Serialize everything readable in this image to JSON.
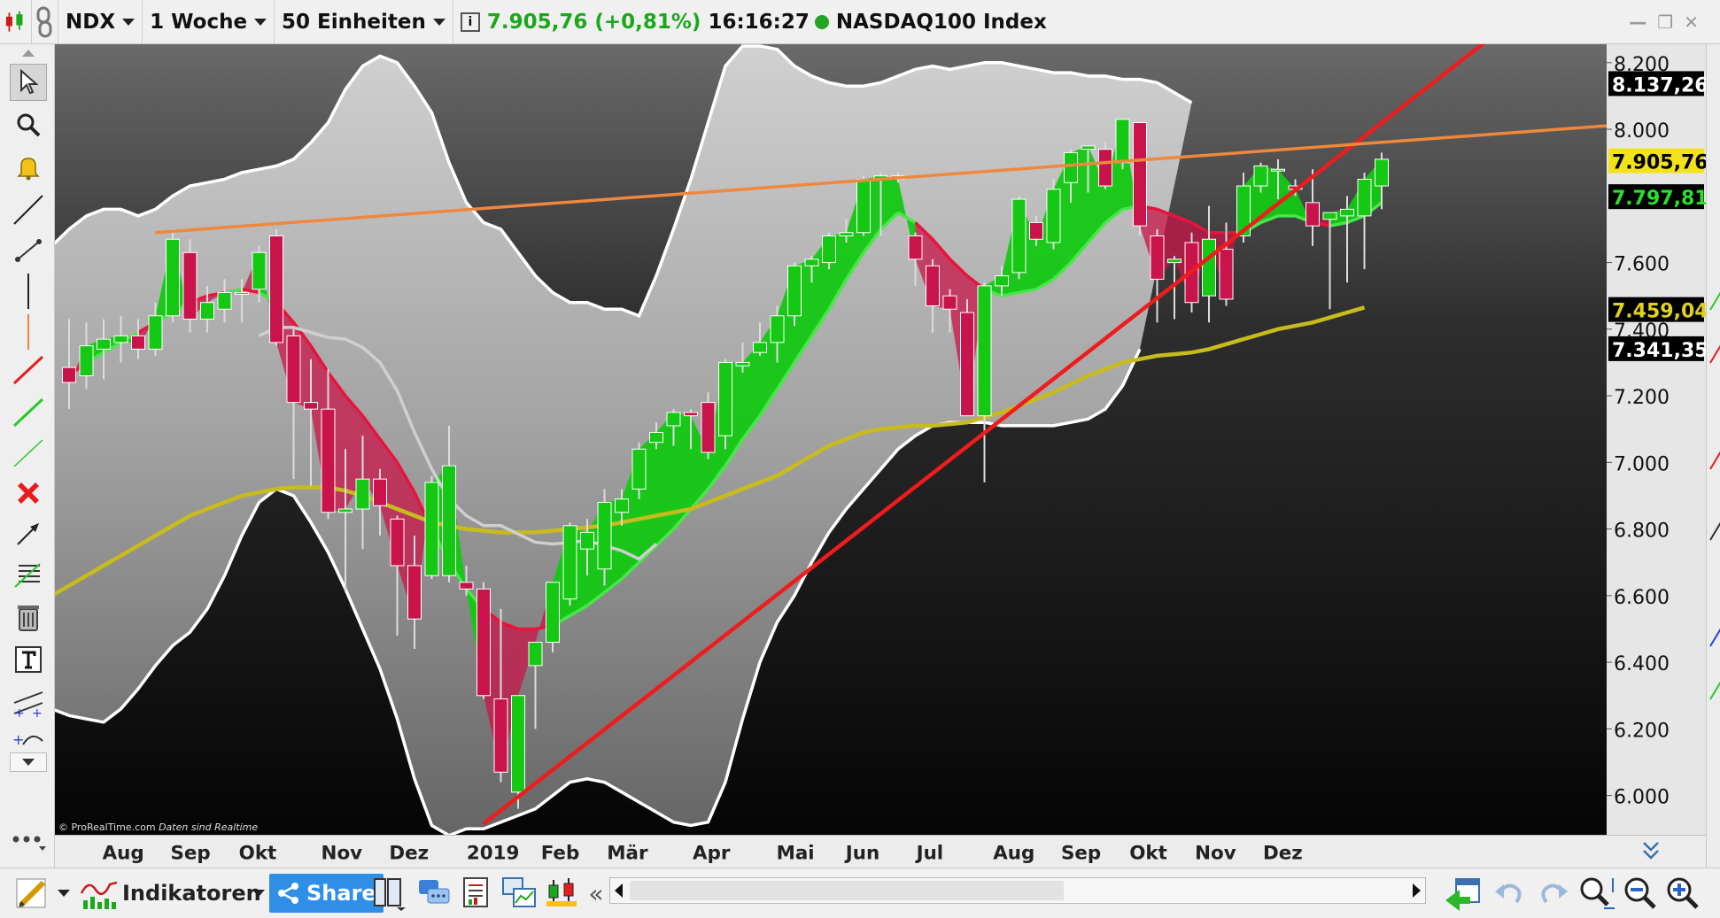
{
  "toolbar": {
    "symbol": "NDX",
    "period": "1 Woche",
    "units": "50 Einheiten",
    "last": "7.905,76",
    "change": "(+0,81%)",
    "time": "16:16:27",
    "instrument": "NASDAQ100 Index"
  },
  "bottom": {
    "indicators_label": "Indikatoren",
    "share_label": "Share"
  },
  "colors": {
    "bull": "#14c814",
    "bear": "#c8144a",
    "trendline": "#ee1c1c",
    "resistance": "#f0883c",
    "ma": "#c8bc1c",
    "band": "#ffffff",
    "live_dot": "#23a523"
  },
  "chart_data": {
    "type": "candlestick",
    "watermark": "© ProRealTime.com",
    "watermark_note": "Daten sind Realtime",
    "x_axis_labels": [
      "Aug",
      "Sep",
      "Okt",
      "Nov",
      "Dez",
      "2019",
      "Feb",
      "Mär",
      "Apr",
      "Mai",
      "Jun",
      "Jul",
      "Aug",
      "Sep",
      "Okt",
      "Nov",
      "Dez"
    ],
    "y_ticks": [
      "8.200",
      "8.000",
      "7.600",
      "7.400",
      "7.200",
      "7.000",
      "6.800",
      "6.600",
      "6.400",
      "6.200",
      "6.000"
    ],
    "ylim": [
      5890,
      8250
    ],
    "price_tags": [
      {
        "label": "8.137,26",
        "value": 8137.26,
        "bg": "#000000",
        "fg": "#ffffff"
      },
      {
        "label": "7.905,76",
        "value": 7905.76,
        "bg": "#f2e21a",
        "fg": "#000000"
      },
      {
        "label": "7.797,81",
        "value": 7797.81,
        "bg": "#000000",
        "fg": "#2be02b"
      },
      {
        "label": "7.459,04",
        "value": 7459.04,
        "bg": "#000000",
        "fg": "#e0d21c"
      },
      {
        "label": "7.341,35",
        "value": 7341.35,
        "bg": "#000000",
        "fg": "#ffffff"
      }
    ],
    "candles": [
      {
        "o": 7285,
        "h": 7430,
        "l": 7160,
        "c": 7240
      },
      {
        "o": 7260,
        "h": 7420,
        "l": 7220,
        "c": 7350
      },
      {
        "o": 7340,
        "h": 7430,
        "l": 7250,
        "c": 7370
      },
      {
        "o": 7360,
        "h": 7440,
        "l": 7300,
        "c": 7380
      },
      {
        "o": 7380,
        "h": 7430,
        "l": 7310,
        "c": 7340
      },
      {
        "o": 7340,
        "h": 7480,
        "l": 7320,
        "c": 7440
      },
      {
        "o": 7440,
        "h": 7700,
        "l": 7420,
        "c": 7670
      },
      {
        "o": 7630,
        "h": 7670,
        "l": 7390,
        "c": 7430
      },
      {
        "o": 7430,
        "h": 7530,
        "l": 7390,
        "c": 7480
      },
      {
        "o": 7460,
        "h": 7550,
        "l": 7420,
        "c": 7510
      },
      {
        "o": 7510,
        "h": 7550,
        "l": 7420,
        "c": 7510
      },
      {
        "o": 7520,
        "h": 7650,
        "l": 7480,
        "c": 7630
      },
      {
        "o": 7680,
        "h": 7700,
        "l": 7350,
        "c": 7360
      },
      {
        "o": 7380,
        "h": 7400,
        "l": 6950,
        "c": 7180
      },
      {
        "o": 7180,
        "h": 7310,
        "l": 6930,
        "c": 7160
      },
      {
        "o": 7160,
        "h": 7280,
        "l": 6830,
        "c": 6850
      },
      {
        "o": 6850,
        "h": 7040,
        "l": 6610,
        "c": 6860
      },
      {
        "o": 6860,
        "h": 7080,
        "l": 6740,
        "c": 6950
      },
      {
        "o": 6950,
        "h": 6980,
        "l": 6780,
        "c": 6870
      },
      {
        "o": 6830,
        "h": 6840,
        "l": 6480,
        "c": 6690
      },
      {
        "o": 6690,
        "h": 6780,
        "l": 6440,
        "c": 6530
      },
      {
        "o": 6660,
        "h": 6960,
        "l": 6650,
        "c": 6940
      },
      {
        "o": 6660,
        "h": 7110,
        "l": 6640,
        "c": 6990
      },
      {
        "o": 6640,
        "h": 6690,
        "l": 6600,
        "c": 6620
      },
      {
        "o": 6620,
        "h": 6640,
        "l": 6290,
        "c": 6300
      },
      {
        "o": 6290,
        "h": 6560,
        "l": 6040,
        "c": 6070
      },
      {
        "o": 6010,
        "h": 6300,
        "l": 5960,
        "c": 6300
      },
      {
        "o": 6390,
        "h": 6450,
        "l": 6200,
        "c": 6460
      },
      {
        "o": 6460,
        "h": 6640,
        "l": 6430,
        "c": 6640
      },
      {
        "o": 6590,
        "h": 6820,
        "l": 6570,
        "c": 6810
      },
      {
        "o": 6740,
        "h": 6830,
        "l": 6660,
        "c": 6790
      },
      {
        "o": 6680,
        "h": 6920,
        "l": 6630,
        "c": 6880
      },
      {
        "o": 6850,
        "h": 6920,
        "l": 6810,
        "c": 6890
      },
      {
        "o": 6920,
        "h": 7060,
        "l": 6890,
        "c": 7040
      },
      {
        "o": 7060,
        "h": 7120,
        "l": 7040,
        "c": 7090
      },
      {
        "o": 7110,
        "h": 7160,
        "l": 7050,
        "c": 7150
      },
      {
        "o": 7150,
        "h": 7160,
        "l": 7040,
        "c": 7140
      },
      {
        "o": 7180,
        "h": 7210,
        "l": 7010,
        "c": 7030
      },
      {
        "o": 7080,
        "h": 7310,
        "l": 7040,
        "c": 7300
      },
      {
        "o": 7290,
        "h": 7360,
        "l": 7270,
        "c": 7300
      },
      {
        "o": 7330,
        "h": 7420,
        "l": 7320,
        "c": 7360
      },
      {
        "o": 7360,
        "h": 7470,
        "l": 7300,
        "c": 7440
      },
      {
        "o": 7440,
        "h": 7600,
        "l": 7410,
        "c": 7590
      },
      {
        "o": 7590,
        "h": 7620,
        "l": 7540,
        "c": 7610
      },
      {
        "o": 7600,
        "h": 7690,
        "l": 7580,
        "c": 7680
      },
      {
        "o": 7680,
        "h": 7730,
        "l": 7660,
        "c": 7690
      },
      {
        "o": 7690,
        "h": 7860,
        "l": 7680,
        "c": 7850
      },
      {
        "o": 7850,
        "h": 7870,
        "l": 7680,
        "c": 7860
      },
      {
        "o": 7860,
        "h": 7870,
        "l": 7840,
        "c": 7850
      },
      {
        "o": 7680,
        "h": 7690,
        "l": 7530,
        "c": 7610
      },
      {
        "o": 7590,
        "h": 7610,
        "l": 7390,
        "c": 7470
      },
      {
        "o": 7500,
        "h": 7520,
        "l": 7390,
        "c": 7460
      },
      {
        "o": 7450,
        "h": 7490,
        "l": 7170,
        "c": 7140
      },
      {
        "o": 7140,
        "h": 7540,
        "l": 6940,
        "c": 7530
      },
      {
        "o": 7530,
        "h": 7590,
        "l": 7500,
        "c": 7560
      },
      {
        "o": 7570,
        "h": 7800,
        "l": 7550,
        "c": 7790
      },
      {
        "o": 7720,
        "h": 7740,
        "l": 7650,
        "c": 7670
      },
      {
        "o": 7660,
        "h": 7850,
        "l": 7640,
        "c": 7820
      },
      {
        "o": 7840,
        "h": 7940,
        "l": 7780,
        "c": 7930
      },
      {
        "o": 7940,
        "h": 7950,
        "l": 7810,
        "c": 7950
      },
      {
        "o": 7940,
        "h": 7960,
        "l": 7820,
        "c": 7830
      },
      {
        "o": 7900,
        "h": 8030,
        "l": 7880,
        "c": 8030
      },
      {
        "o": 8020,
        "h": 8020,
        "l": 7680,
        "c": 7710
      },
      {
        "o": 7680,
        "h": 7700,
        "l": 7420,
        "c": 7550
      },
      {
        "o": 7600,
        "h": 7620,
        "l": 7430,
        "c": 7610
      },
      {
        "o": 7660,
        "h": 7690,
        "l": 7450,
        "c": 7480
      },
      {
        "o": 7500,
        "h": 7770,
        "l": 7420,
        "c": 7670
      },
      {
        "o": 7640,
        "h": 7720,
        "l": 7470,
        "c": 7490
      },
      {
        "o": 7680,
        "h": 7870,
        "l": 7660,
        "c": 7830
      },
      {
        "o": 7830,
        "h": 7900,
        "l": 7810,
        "c": 7890
      },
      {
        "o": 7880,
        "h": 7910,
        "l": 7790,
        "c": 7880
      },
      {
        "o": 7830,
        "h": 7850,
        "l": 7800,
        "c": 7820
      },
      {
        "o": 7780,
        "h": 7880,
        "l": 7650,
        "c": 7710
      },
      {
        "o": 7730,
        "h": 7750,
        "l": 7460,
        "c": 7750
      },
      {
        "o": 7740,
        "h": 7800,
        "l": 7540,
        "c": 7760
      },
      {
        "o": 7740,
        "h": 7870,
        "l": 7580,
        "c": 7850
      },
      {
        "o": 7830,
        "h": 7930,
        "l": 7760,
        "c": 7910
      }
    ],
    "ichimoku_line": [
      7260,
      7300,
      7330,
      7360,
      7390,
      7420,
      7450,
      7480,
      7500,
      7510,
      7520,
      7510,
      7480,
      7420,
      7350,
      7270,
      7200,
      7140,
      7070,
      7000,
      6910,
      6800,
      6700,
      6620,
      6560,
      6520,
      6500,
      6500,
      6510,
      6540,
      6570,
      6610,
      6650,
      6700,
      6750,
      6800,
      6860,
      6920,
      6990,
      7070,
      7140,
      7220,
      7300,
      7380,
      7460,
      7550,
      7630,
      7700,
      7750,
      7720,
      7670,
      7610,
      7560,
      7520,
      7500,
      7510,
      7520,
      7550,
      7600,
      7660,
      7720,
      7760,
      7770,
      7760,
      7740,
      7720,
      7690,
      7690,
      7690,
      7720,
      7740,
      7740,
      7720,
      7710,
      7720,
      7740,
      7780
    ],
    "ma_yellow": [
      6600,
      6630,
      6660,
      6690,
      6720,
      6750,
      6780,
      6810,
      6840,
      6860,
      6880,
      6900,
      6910,
      6920,
      6925,
      6925,
      6925,
      6915,
      6900,
      6880,
      6860,
      6840,
      6820,
      6810,
      6800,
      6795,
      6790,
      6790,
      6790,
      6795,
      6800,
      6805,
      6810,
      6820,
      6830,
      6840,
      6850,
      6860,
      6880,
      6900,
      6920,
      6940,
      6960,
      6990,
      7020,
      7050,
      7070,
      7090,
      7100,
      7105,
      7110,
      7110,
      7115,
      7120,
      7135,
      7150,
      7170,
      7190,
      7210,
      7235,
      7260,
      7280,
      7300,
      7310,
      7320,
      7325,
      7330,
      7340,
      7355,
      7370,
      7385,
      7400,
      7410,
      7420,
      7435,
      7450,
      7465
    ],
    "bb_upper": [
      7650,
      7700,
      7740,
      7760,
      7760,
      7740,
      7760,
      7800,
      7830,
      7840,
      7850,
      7870,
      7880,
      7890,
      7910,
      7960,
      8020,
      8120,
      8190,
      8220,
      8200,
      8130,
      8050,
      7900,
      7780,
      7720,
      7700,
      7630,
      7560,
      7510,
      7480,
      7480,
      7460,
      7460,
      7440,
      7560,
      7700,
      7850,
      8020,
      8190,
      8250,
      8250,
      8240,
      8190,
      8160,
      8140,
      8130,
      8130,
      8140,
      8160,
      8180,
      8190,
      8180,
      8190,
      8200,
      8200,
      8190,
      8180,
      8170,
      8170,
      8160,
      8160,
      8150,
      8150,
      8140,
      8110,
      8080
    ],
    "bb_lower": [
      6260,
      6240,
      6230,
      6220,
      6260,
      6320,
      6390,
      6450,
      6490,
      6560,
      6660,
      6780,
      6880,
      6920,
      6900,
      6820,
      6730,
      6620,
      6500,
      6380,
      6230,
      6050,
      5910,
      5880,
      5900,
      5900,
      5920,
      5940,
      5960,
      6000,
      6040,
      6050,
      6040,
      6010,
      5980,
      5950,
      5920,
      5910,
      5920,
      6040,
      6230,
      6400,
      6520,
      6600,
      6700,
      6790,
      6860,
      6920,
      6980,
      7040,
      7080,
      7110,
      7120,
      7120,
      7120,
      7110,
      7110,
      7110,
      7110,
      7120,
      7130,
      7160,
      7230,
      7340
    ],
    "trendline": {
      "from": {
        "i": 24,
        "v": 5915
      },
      "to": {
        "i": 80,
        "v": 8190
      }
    },
    "resistance": {
      "from": {
        "i": 5,
        "v": 7690
      },
      "to": {
        "i": 80,
        "v": 8000
      }
    },
    "month_tick_index": [
      2,
      6,
      10,
      15,
      19,
      24,
      28,
      32,
      37,
      42,
      46,
      50,
      55,
      59,
      63,
      67,
      71
    ]
  }
}
